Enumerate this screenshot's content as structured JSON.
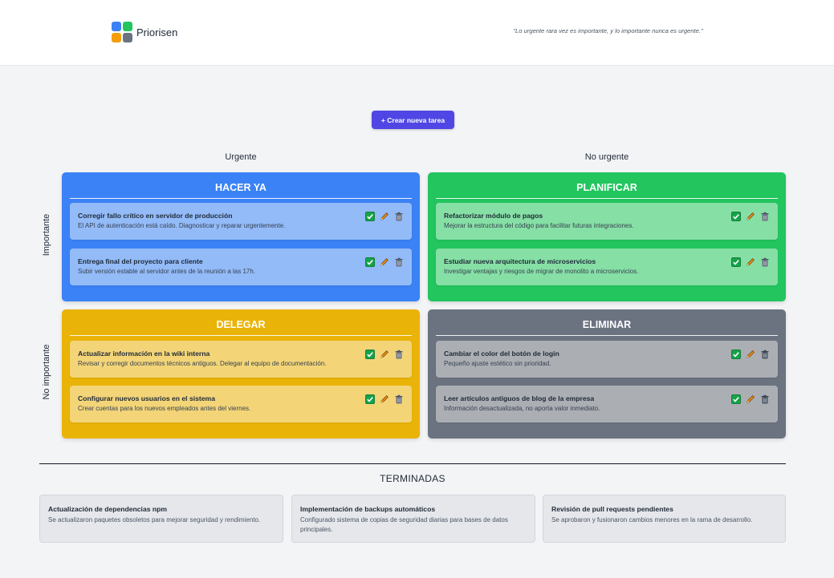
{
  "app": {
    "name": "Priorisen",
    "quote": "\"Lo urgente rara vez es importante, y lo importante nunca es urgente.\"",
    "logo_colors": [
      "#3b82f6",
      "#22c55e",
      "#f59e0b",
      "#6b7280"
    ]
  },
  "toolbar": {
    "create_label": "+ Crear nueva tarea"
  },
  "axes": {
    "urgent": "Urgente",
    "not_urgent": "No urgente",
    "important": "Importante",
    "not_important": "No importante"
  },
  "quadrants": {
    "do": {
      "title": "HACER YA",
      "color": "#3b82f6",
      "card_color": "#93bbf8",
      "tasks": [
        {
          "title": "Corregir fallo crítico en servidor de producción",
          "desc": "El API de autenticación está caído. Diagnosticar y reparar urgentemente."
        },
        {
          "title": "Entrega final del proyecto para cliente",
          "desc": "Subir versión estable al servidor antes de la reunión a las 17h."
        }
      ]
    },
    "plan": {
      "title": "PLANIFICAR",
      "color": "#22c55e",
      "card_color": "#86dfa5",
      "tasks": [
        {
          "title": "Refactorizar módulo de pagos",
          "desc": "Mejorar la estructura del código para facilitar futuras integraciones."
        },
        {
          "title": "Estudiar nueva arquitectura de microservicios",
          "desc": "Investigar ventajas y riesgos de migrar de monolito a microservicios."
        }
      ]
    },
    "delegate": {
      "title": "DELEGAR",
      "color": "#eab308",
      "card_color": "#f3d578",
      "tasks": [
        {
          "title": "Actualizar información en la wiki interna",
          "desc": "Revisar y corregir documentos técnicos antiguos. Delegar al equipo de documentación."
        },
        {
          "title": "Configurar nuevos usuarios en el sistema",
          "desc": "Crear cuentas para los nuevos empleados antes del viernes."
        }
      ]
    },
    "eliminate": {
      "title": "ELIMINAR",
      "color": "#6b7280",
      "card_color": "#abaeb3",
      "tasks": [
        {
          "title": "Cambiar el color del botón de login",
          "desc": "Pequeño ajuste estético sin prioridad."
        },
        {
          "title": "Leer artículos antiguos de blog de la empresa",
          "desc": "Información desactualizada, no aporta valor inmediato."
        }
      ]
    }
  },
  "icons": {
    "complete": "check-icon",
    "edit": "pencil-icon",
    "delete": "trash-icon"
  },
  "completed": {
    "title": "TERMINADAS",
    "items": [
      {
        "title": "Actualización de dependencias npm",
        "desc": "Se actualizaron paquetes obsoletos para mejorar seguridad y rendimiento."
      },
      {
        "title": "Implementación de backups automáticos",
        "desc": "Configurado sistema de copias de seguridad diarias para bases de datos principales."
      },
      {
        "title": "Revisión de pull requests pendientes",
        "desc": "Se aprobaron y fusionaron cambios menores en la rama de desarrollo."
      }
    ]
  }
}
